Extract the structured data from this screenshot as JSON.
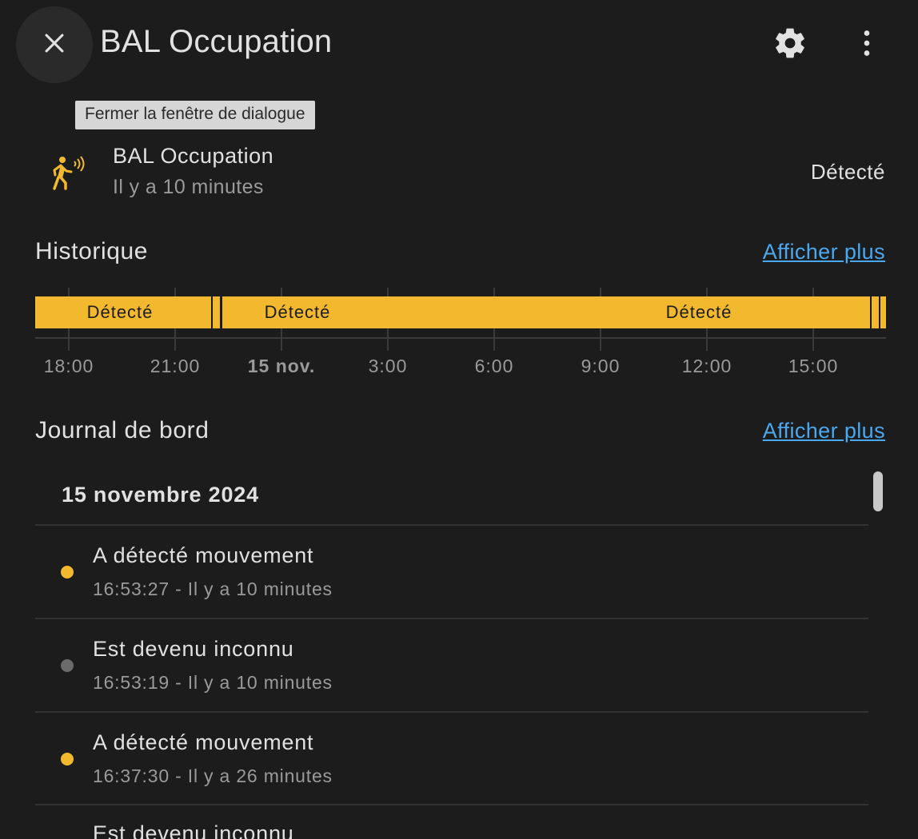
{
  "dialog": {
    "title": "BAL Occupation",
    "close_tooltip": "Fermer la fenêtre de dialogue",
    "icons": {
      "close": "close-icon",
      "settings": "gear-icon",
      "more": "dots-vertical-icon"
    }
  },
  "entity": {
    "name": "BAL Occupation",
    "last_changed": "Il y a 10 minutes",
    "state": "Détecté",
    "icon": "motion-sensor-icon",
    "icon_color": "#f3b92e"
  },
  "history": {
    "title": "Historique",
    "more_label": "Afficher plus",
    "bar_color": "#f3b92e",
    "segments": [
      {
        "label": "Détecté"
      },
      {
        "label": "Détecté"
      },
      {
        "label": "Détecté"
      }
    ],
    "ticks": [
      "18:00",
      "21:00",
      "15 nov.",
      "3:00",
      "6:00",
      "9:00",
      "12:00",
      "15:00"
    ]
  },
  "logbook": {
    "title": "Journal de bord",
    "more_label": "Afficher plus",
    "date_header": "15 novembre 2024",
    "entries": [
      {
        "title": "A détecté mouvement",
        "sub": "16:53:27 - Il y a 10 minutes",
        "dot_color": "#f3b92e"
      },
      {
        "title": "Est devenu inconnu",
        "sub": "16:53:19 - Il y a 10 minutes",
        "dot_color": "#6b6b6b"
      },
      {
        "title": "A détecté mouvement",
        "sub": "16:37:30 - Il y a 26 minutes",
        "dot_color": "#f3b92e"
      },
      {
        "title": "Est devenu inconnu",
        "sub": "",
        "dot_color": "#6b6b6b"
      }
    ]
  }
}
